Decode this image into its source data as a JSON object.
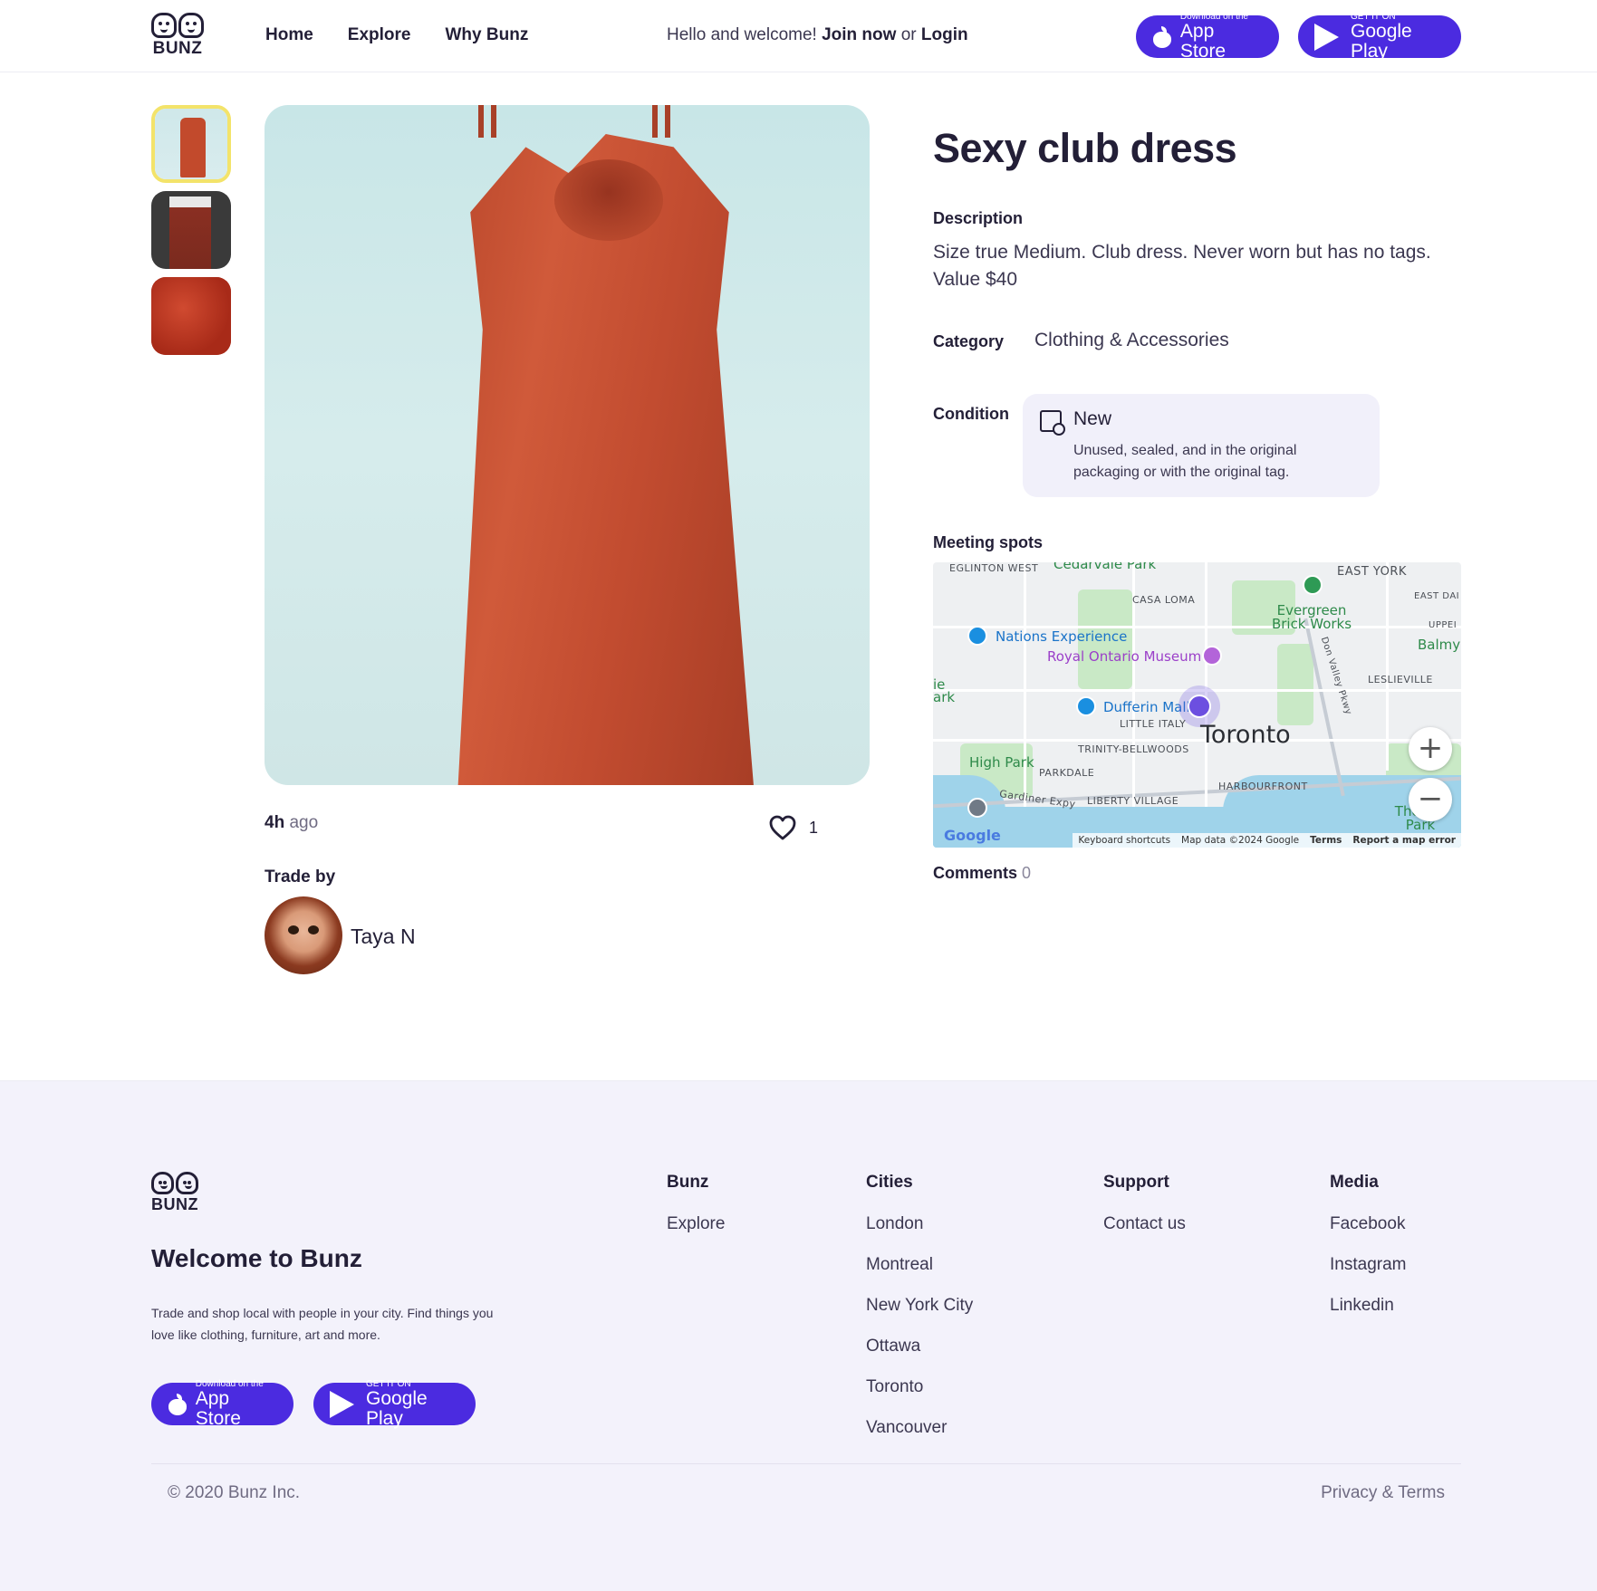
{
  "header": {
    "logo_text": "BUNZ",
    "nav": [
      "Home",
      "Explore",
      "Why Bunz"
    ],
    "welcome_prefix": "Hello and welcome!",
    "join_label": "Join now",
    "or_text": "or",
    "login_label": "Login",
    "app_store": {
      "small": "Download on the",
      "big": "App Store"
    },
    "google_play": {
      "small": "GET IT ON",
      "big": "Google Play"
    }
  },
  "listing": {
    "title": "Sexy club dress",
    "description_label": "Description",
    "description": "Size true Medium. Club dress. Never worn but has no tags. Value $40",
    "category_label": "Category",
    "category": "Clothing & Accessories",
    "condition_label": "Condition",
    "condition": "New",
    "condition_desc": "Unused, sealed, and in the original packaging or with the original tag.",
    "meeting_label": "Meeting spots",
    "time_value": "4h",
    "time_suffix": "ago",
    "likes": "1",
    "trade_by_label": "Trade by",
    "trader_name": "Taya N",
    "comments_label": "Comments",
    "comments_count": "0"
  },
  "map": {
    "labels": {
      "eglinton": "EGLINTON WEST",
      "cedarvale": "Cedarvale Park",
      "east_york": "EAST YORK",
      "east_dan": "EAST DAI",
      "casa_loma": "CASA LOMA",
      "evergreen": "Evergreen Brick Works",
      "upper": "UPPEI",
      "balmy": "Balmy",
      "nations": "Nations Experience",
      "rom": "Royal Ontario Museum",
      "leslieville": "LESLIEVILLE",
      "ie_ark": "ie ark",
      "dufferin": "Dufferin Mall",
      "little_italy": "LITTLE ITALY",
      "toronto": "Toronto",
      "trinity": "TRINITY-BELLWOODS",
      "high_park": "High Park",
      "parkdale": "PARKDALE",
      "harbourfront": "HARBOURFRONT",
      "gardiner": "Gardiner Expy",
      "liberty": "LIBERTY VILLAGE",
      "don_valley": "Don Valley Pkwy",
      "the_park": "The Par Park"
    },
    "zoom_in": "+",
    "zoom_out": "−",
    "google": "Google",
    "attribution": {
      "shortcuts": "Keyboard shortcuts",
      "mapdata": "Map data ©2024 Google",
      "terms": "Terms",
      "report": "Report a map error"
    }
  },
  "footer": {
    "logo_text": "BUNZ",
    "welcome": "Welcome to Bunz",
    "text": "Trade and shop local with people in your city. Find things you love like clothing, furniture, art and more.",
    "columns": [
      {
        "title": "Bunz",
        "items": [
          "Explore"
        ]
      },
      {
        "title": "Cities",
        "items": [
          "London",
          "Montreal",
          "New York City",
          "Ottawa",
          "Toronto",
          "Vancouver"
        ]
      },
      {
        "title": "Support",
        "items": [
          "Contact us"
        ]
      },
      {
        "title": "Media",
        "items": [
          "Facebook",
          "Instagram",
          "Linkedin"
        ]
      }
    ],
    "copyright": "© 2020 Bunz Inc.",
    "privacy": "Privacy & Terms"
  },
  "colors": {
    "brand": "#4b2be0",
    "text": "#231f37",
    "active_thumb_border": "#f3e36a",
    "footer_bg": "#f3f2fb",
    "condition_bg": "#f1f0fa"
  }
}
